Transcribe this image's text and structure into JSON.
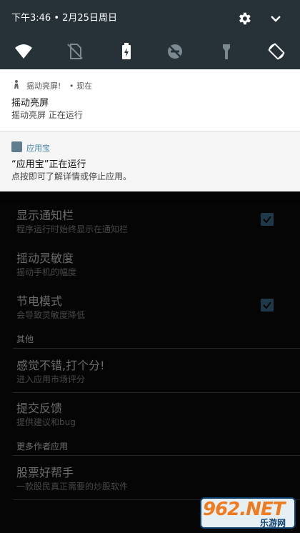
{
  "status_bar": {
    "datetime": "下午3:46 • 2月25日周日"
  },
  "quick_settings": {
    "tiles": [
      "wifi-icon",
      "no-sim-icon",
      "battery-charging-icon",
      "do-not-disturb-off-icon",
      "flashlight-icon",
      "auto-rotate-icon"
    ]
  },
  "notifications": [
    {
      "app": "摇动亮屏!",
      "time": "• 现在",
      "title": "摇动亮屏",
      "text": "摇动亮屏 正在运行"
    },
    {
      "app": "应用宝",
      "title": "“应用宝”正在运行",
      "text": "点按即可了解详情或停止应用。"
    }
  ],
  "settings": {
    "items": [
      {
        "title": "显示通知栏",
        "subtitle": "程序运行时始终显示在通知栏",
        "checked": true
      },
      {
        "title": "摇动灵敏度",
        "subtitle": "摇动手机的幅度"
      },
      {
        "title": "节电模式",
        "subtitle": "会导致灵敏度降低",
        "checked": true
      }
    ],
    "section_other": "其他",
    "other_items": [
      {
        "title": "感觉不错,打个分!",
        "subtitle": "进入应用市场评分"
      },
      {
        "title": "提交反馈",
        "subtitle": "提供建议和bug"
      }
    ],
    "section_more": "更多作者应用",
    "more_items": [
      {
        "title": "股票好帮手",
        "subtitle": "一款股民真正需要的炒股软件"
      }
    ]
  },
  "watermark": {
    "logo_text": "962.NET",
    "caption": "乐游网"
  },
  "colors": {
    "qs_background": "#263238",
    "shade_background": "#f5f5f5",
    "app_background": "#050505",
    "check_fill": "#1e3a4a",
    "accent_blue": "#3f7fa6"
  }
}
